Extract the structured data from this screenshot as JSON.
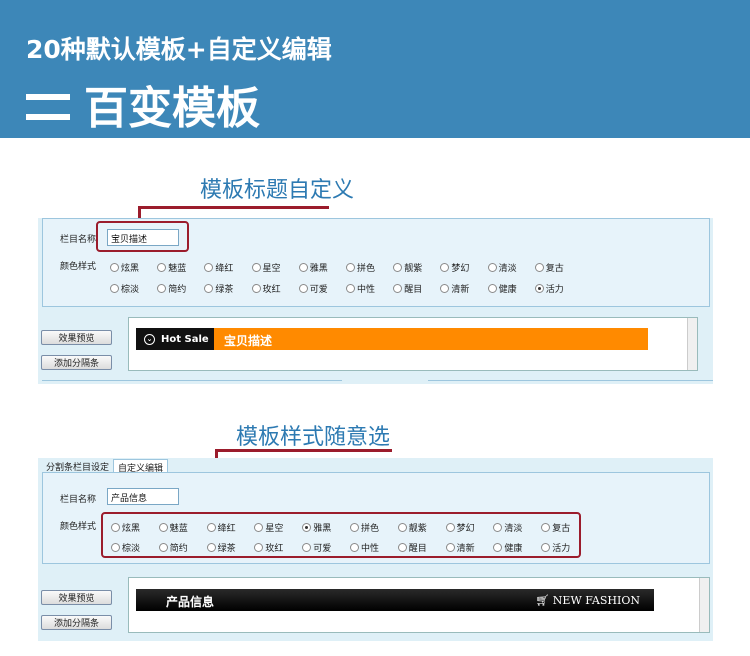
{
  "banner": {
    "line1": "20种默认模板+自定义编辑",
    "line2": "百变模板"
  },
  "sections": [
    {
      "caption": "模板标题自定义",
      "name_label": "栏目名称",
      "name_value": "宝贝描述",
      "style_label": "颜色样式",
      "styles_row1": [
        "炫黑",
        "魅蓝",
        "绛红",
        "星空",
        "雅黑",
        "拼色",
        "靓紫",
        "梦幻",
        "清淡",
        "复古"
      ],
      "styles_row2": [
        "棕淡",
        "简约",
        "绿茶",
        "玫红",
        "可爱",
        "中性",
        "醒目",
        "清新",
        "健康",
        "活力"
      ],
      "selected": "活力",
      "btn_preview": "效果预览",
      "btn_add": "添加分隔条",
      "hot_sale": "Hot Sale",
      "preview_title": "宝贝描述"
    },
    {
      "caption": "模板样式随意选",
      "tabs": [
        "分割条栏目设定",
        "自定义编辑"
      ],
      "name_label": "栏目名称",
      "name_value": "产品信息",
      "style_label": "颜色样式",
      "styles_row1": [
        "炫黑",
        "魅蓝",
        "绛红",
        "星空",
        "雅黑",
        "拼色",
        "靓紫",
        "梦幻",
        "清淡",
        "复古"
      ],
      "styles_row2": [
        "棕淡",
        "简约",
        "绿茶",
        "玫红",
        "可爱",
        "中性",
        "醒目",
        "清新",
        "健康",
        "活力"
      ],
      "selected": "雅黑",
      "btn_preview": "效果预览",
      "btn_add": "添加分隔条",
      "preview_title": "产品信息",
      "fashion": "NEW FASHION"
    }
  ],
  "colors": {
    "banner": "#3d87b8",
    "caption": "#2d7ab2",
    "highlight": "#9b1c2c",
    "orange": "#ff8a00"
  }
}
